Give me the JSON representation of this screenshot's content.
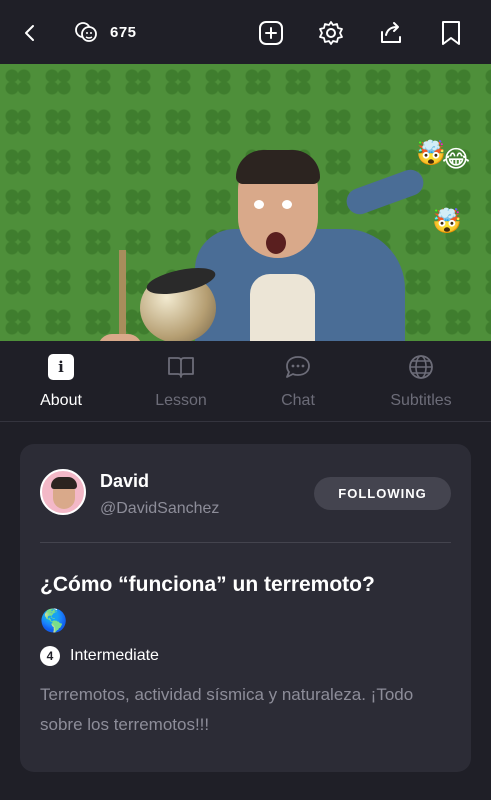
{
  "topbar": {
    "viewer_count": "675",
    "icons": [
      "back-icon",
      "viewers-icon",
      "add-icon",
      "settings-icon",
      "share-icon",
      "bookmark-icon"
    ]
  },
  "video": {
    "reaction_emojis": [
      "🤯",
      "😂",
      "🤯"
    ]
  },
  "tabs": [
    {
      "label": "About",
      "icon": "info-icon",
      "active": true
    },
    {
      "label": "Lesson",
      "icon": "book-icon",
      "active": false
    },
    {
      "label": "Chat",
      "icon": "chat-icon",
      "active": false
    },
    {
      "label": "Subtitles",
      "icon": "globe-icon",
      "active": false
    }
  ],
  "card": {
    "author_name": "David",
    "author_handle": "@DavidSanchez",
    "follow_label": "FOLLOWING",
    "title": "¿Cómo “funciona” un terremoto?",
    "title_emoji": "🌎",
    "level_number": "4",
    "level_label": "Intermediate",
    "description": "Terremotos, actividad sísmica y naturaleza. ¡Todo sobre los terremotos!!!"
  },
  "colors": {
    "background": "#1f1f27",
    "card": "#2c2c36",
    "muted_text": "#8d8d99",
    "inactive_tab": "#6c6c78",
    "video_green": "#4e8f3a"
  }
}
